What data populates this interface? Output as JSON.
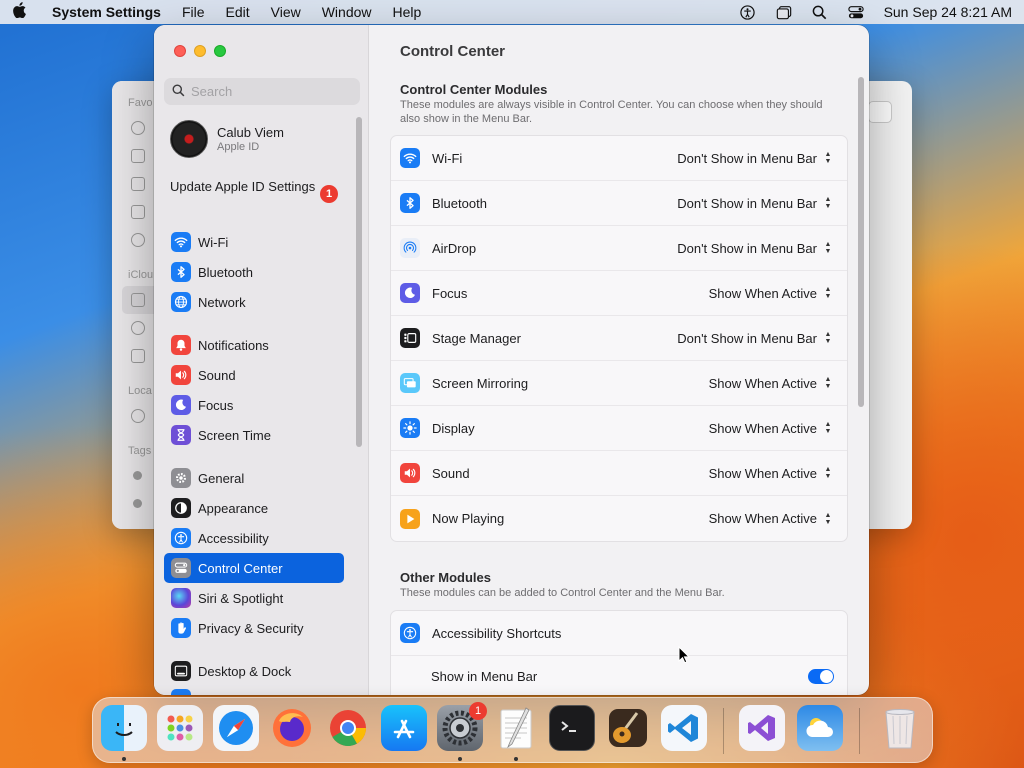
{
  "menubar": {
    "app_name": "System Settings",
    "menus": [
      "File",
      "Edit",
      "View",
      "Window",
      "Help"
    ],
    "clock": "Sun Sep 24  8:21 AM"
  },
  "sidebar": {
    "search_placeholder": "Search",
    "profile": {
      "name": "Calub Viem",
      "subtitle": "Apple ID"
    },
    "update": {
      "label": "Update Apple ID Settings",
      "badge": "1"
    },
    "items": [
      {
        "label": "Wi-Fi",
        "icon": "wifi-icon",
        "color": "#1a7cf5"
      },
      {
        "label": "Bluetooth",
        "icon": "bluetooth-icon",
        "color": "#1a7cf5"
      },
      {
        "label": "Network",
        "icon": "globe-icon",
        "color": "#1a7cf5"
      },
      {
        "label": "Notifications",
        "icon": "bell-icon",
        "color": "#f1453d"
      },
      {
        "label": "Sound",
        "icon": "speaker-icon",
        "color": "#f1453d"
      },
      {
        "label": "Focus",
        "icon": "moon-icon",
        "color": "#5e5ce6"
      },
      {
        "label": "Screen Time",
        "icon": "hourglass-icon",
        "color": "#6e4fd6"
      },
      {
        "label": "General",
        "icon": "gear-icon",
        "color": "#8e8e93"
      },
      {
        "label": "Appearance",
        "icon": "appearance-icon",
        "color": "#1d1d1f"
      },
      {
        "label": "Accessibility",
        "icon": "accessibility-icon",
        "color": "#1a7cf5"
      },
      {
        "label": "Control Center",
        "icon": "control-center-icon",
        "color": "#8e8e93"
      },
      {
        "label": "Siri & Spotlight",
        "icon": "siri-icon",
        "color": "#b14ccf"
      },
      {
        "label": "Privacy & Security",
        "icon": "hand-icon",
        "color": "#1a7cf5"
      },
      {
        "label": "Desktop & Dock",
        "icon": "dock-icon",
        "color": "#1d1d1f"
      }
    ],
    "selected": "Control Center"
  },
  "main": {
    "title": "Control Center",
    "modules_section": {
      "title": "Control Center Modules",
      "description": "These modules are always visible in Control Center. You can choose when they should also show in the Menu Bar.",
      "rows": [
        {
          "label": "Wi-Fi",
          "value": "Don't Show in Menu Bar",
          "icon": "wifi-icon",
          "color": "#1a7cf5"
        },
        {
          "label": "Bluetooth",
          "value": "Don't Show in Menu Bar",
          "icon": "bluetooth-icon",
          "color": "#1a7cf5"
        },
        {
          "label": "AirDrop",
          "value": "Don't Show in Menu Bar",
          "icon": "airdrop-icon",
          "color": "#e9eef7"
        },
        {
          "label": "Focus",
          "value": "Show When Active",
          "icon": "moon-icon",
          "color": "#5e5ce6"
        },
        {
          "label": "Stage Manager",
          "value": "Don't Show in Menu Bar",
          "icon": "stage-manager-icon",
          "color": "#1d1d1f"
        },
        {
          "label": "Screen Mirroring",
          "value": "Show When Active",
          "icon": "screen-mirroring-icon",
          "color": "#5ac8fa"
        },
        {
          "label": "Display",
          "value": "Show When Active",
          "icon": "sun-icon",
          "color": "#1a7cf5"
        },
        {
          "label": "Sound",
          "value": "Show When Active",
          "icon": "speaker-icon",
          "color": "#f1453d"
        },
        {
          "label": "Now Playing",
          "value": "Show When Active",
          "icon": "play-icon",
          "color": "#f7a21b"
        }
      ]
    },
    "other_section": {
      "title": "Other Modules",
      "description": "These modules can be added to Control Center and the Menu Bar.",
      "accessibility_label": "Accessibility Shortcuts",
      "show_in_menu_bar_label": "Show in Menu Bar",
      "show_in_menu_bar_on": true
    }
  },
  "dock": {
    "settings_badge": "1",
    "apps": [
      "Finder",
      "Launchpad",
      "Safari",
      "Firefox",
      "Chrome",
      "App Store",
      "System Settings",
      "TextEdit",
      "Terminal",
      "GarageBand",
      "VS Code",
      "Visual Studio",
      "Weather",
      "Trash"
    ]
  }
}
